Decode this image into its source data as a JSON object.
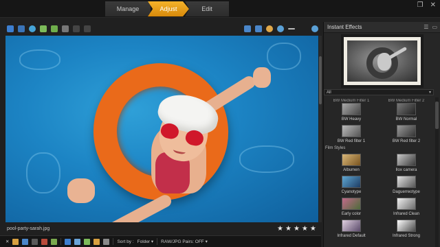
{
  "tabs": [
    {
      "label": "Manage"
    },
    {
      "label": "Adjust"
    },
    {
      "label": "Edit"
    }
  ],
  "window_controls": {
    "restore": "❐",
    "close": "✕"
  },
  "image": {
    "filename": "pool-party-sarah.jpg",
    "rating_stars": [
      "★",
      "★",
      "★",
      "★",
      "★"
    ]
  },
  "bottom_bar": {
    "sort_label": "Sort by :",
    "sort_value": "Folder ▾",
    "pairs_label": "RAW/JPG Pairs: OFF ▾"
  },
  "panel": {
    "title": "Instant Effects",
    "filter_value": "All",
    "cut_labels": [
      "BW Medium Filter 1",
      "BW Medium Filter 2"
    ],
    "rows": [
      [
        {
          "label": "BW Heavy",
          "swatch": "t-bw1"
        },
        {
          "label": "BW Normal",
          "swatch": "t-bw2"
        }
      ],
      [
        {
          "label": "BW Red filter 1",
          "swatch": "t-bw3"
        },
        {
          "label": "BW Red filter 2",
          "swatch": "t-bw4"
        }
      ]
    ],
    "section": "Film Styles",
    "film_rows": [
      [
        {
          "label": "Albumen",
          "swatch": "t-alb"
        },
        {
          "label": "Ilox camera",
          "swatch": "t-ilbox"
        }
      ],
      [
        {
          "label": "Cyanotype",
          "swatch": "t-cyan"
        },
        {
          "label": "Daguerreotype",
          "swatch": "t-dag"
        }
      ],
      [
        {
          "label": "Early color",
          "swatch": "t-early"
        },
        {
          "label": "Infrared Clean",
          "swatch": "t-infc"
        }
      ],
      [
        {
          "label": "Infrared Default",
          "swatch": "t-infd"
        },
        {
          "label": "Infrared Strong",
          "swatch": "t-infs"
        }
      ]
    ]
  }
}
